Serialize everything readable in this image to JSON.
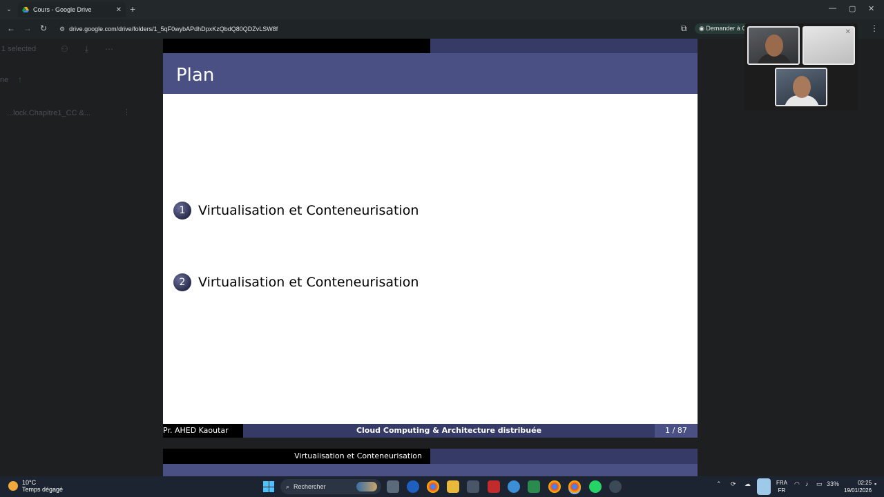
{
  "browser": {
    "tab_title": "Cours - Google Drive",
    "url": "drive.google.com/drive/folders/1_5qF0wybAPdhDpxKzQbdQ80QDZvLSW8f",
    "ask_button": "Demander à C",
    "new_tab": "+"
  },
  "drive": {
    "selection": "1 selected",
    "folder_partial": "ne",
    "file_name": "...lock.Chapitre1_CC &..."
  },
  "slide": {
    "title": "Plan",
    "sections": [
      {
        "num": "1",
        "label": "Virtualisation et Conteneurisation"
      },
      {
        "num": "2",
        "label": "Virtualisation et Conteneurisation"
      }
    ],
    "footer": {
      "author": "Pr. AHED Kaoutar",
      "course": "Cloud Computing & Architecture distribuée",
      "page": "1 / 87"
    }
  },
  "slide2": {
    "header_section": "Virtualisation et Conteneurisation"
  },
  "taskbar": {
    "temperature": "10°C",
    "weather": "Temps dégagé",
    "search_placeholder": "Rechercher",
    "lang_top": "FRA",
    "lang_bottom": "FR",
    "battery": "33%",
    "time": "02:25",
    "date": "19/01/2026"
  }
}
